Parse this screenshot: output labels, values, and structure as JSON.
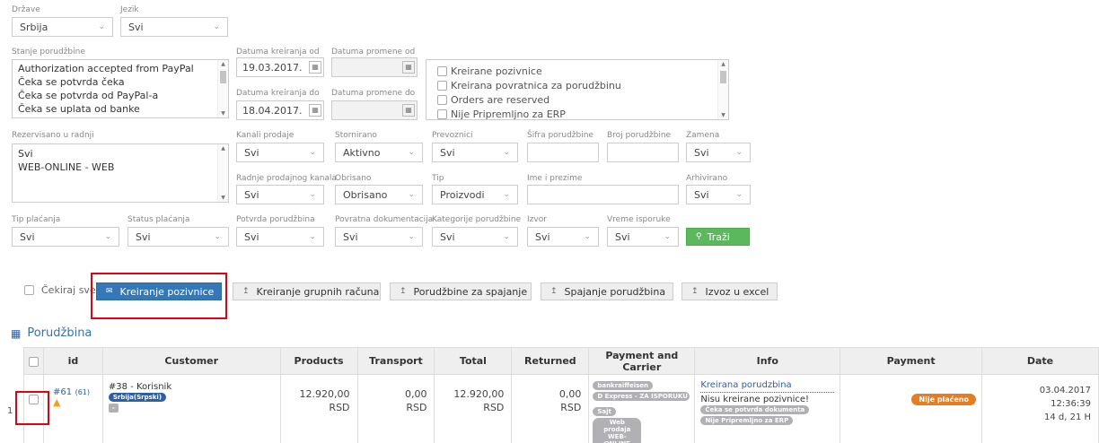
{
  "filters": {
    "drzave": {
      "label": "Države",
      "value": "Srbija"
    },
    "jezik": {
      "label": "Jezik",
      "value": "Svi"
    },
    "stanje": {
      "label": "Stanje porudžbine",
      "items": [
        "Authorization accepted from PayPal",
        "Čeka se potvrda čeka",
        "Čeka se potvrda od PayPal-a",
        "Čeka se uplata od banke"
      ]
    },
    "datum_kreiranja_od": {
      "label": "Datuma kreiranja od",
      "value": "19.03.2017."
    },
    "datum_promene_od": {
      "label": "Datuma promene od",
      "value": ""
    },
    "datum_kreiranja_do": {
      "label": "Datuma kreiranja do",
      "value": "18.04.2017."
    },
    "datum_promene_do": {
      "label": "Datuma promene do",
      "value": ""
    },
    "check_list": [
      "Kreirane pozivnice",
      "Kreirana povratnica za porudžbinu",
      "Orders are reserved",
      "Nije Pripremljno za ERP"
    ],
    "rezervisano": {
      "label": "Rezervisano u radnji",
      "items": [
        "Svi",
        "WEB-ONLINE - WEB"
      ]
    },
    "kanali": {
      "label": "Kanali prodaje",
      "value": "Svi"
    },
    "stornirano": {
      "label": "Stornirano",
      "value": "Aktivno"
    },
    "prevoznici": {
      "label": "Prevoznici",
      "value": "Svi"
    },
    "sifra": {
      "label": "Šifra porudžbine",
      "value": ""
    },
    "broj": {
      "label": "Broj porudžbine",
      "value": ""
    },
    "zamena": {
      "label": "Zamena",
      "value": "Svi"
    },
    "radnje_kanala": {
      "label": "Radnje prodajnog kanala",
      "value": "Svi"
    },
    "obrisano": {
      "label": "Obrisano",
      "value": "Obrisano"
    },
    "tip": {
      "label": "Tip",
      "value": "Proizvodi"
    },
    "ime": {
      "label": "Ime i prezime",
      "value": ""
    },
    "arhivirano": {
      "label": "Arhivirano",
      "value": "Svi"
    },
    "tip_placanja": {
      "label": "Tip plaćanja",
      "value": "Svi"
    },
    "status_placanja": {
      "label": "Status plaćanja",
      "value": "Svi"
    },
    "potvrda": {
      "label": "Potvrda porudžbina",
      "value": "Svi"
    },
    "povratna": {
      "label": "Povratna dokumentacija",
      "value": "Svi"
    },
    "kategorije": {
      "label": "Kategorije porudžbine",
      "value": "Svi"
    },
    "izvor": {
      "label": "Izvor",
      "value": "Svi"
    },
    "vreme": {
      "label": "Vreme isporuke",
      "value": "Svi"
    },
    "trazi": "Traži"
  },
  "actions": {
    "cekiraj": "Čekiraj sve",
    "kreiranje_pozivnice": "Kreiranje pozivnice",
    "grupnih": "Kreiranje grupnih računa",
    "za_spajanje": "Porudžbine za spajanje",
    "spajanje": "Spajanje porudžbina",
    "izvoz": "Izvoz u excel"
  },
  "section_title": "Porudžbina",
  "table": {
    "headers": [
      "id",
      "Customer",
      "Products",
      "Transport",
      "Total",
      "Returned",
      "Payment and Carrier",
      "Info",
      "Payment",
      "Date"
    ],
    "row": {
      "index": "1",
      "id": "#61",
      "id_sub": "(61)",
      "customer": "#38 - Korisnik",
      "customer_tag": "Srbija(Srpski)",
      "customer_extra": "-",
      "products": "12.920,00",
      "transport": "0,00",
      "total": "12.920,00",
      "returned": "0,00",
      "currency": "RSD",
      "carrier_tags": [
        "bankraiffeisen",
        "D Express - ZA ISPORUKU PO...",
        "Sajt",
        "Web prodaja WEB-ONLINE"
      ],
      "info_link": "Kreirana porudzbina",
      "info_text": "Nisu kreirane pozivnice!",
      "info_tags": [
        "Čeka se potvrda dokumenta",
        "Nije Pripremljno za ERP"
      ],
      "payment_tag": "Nije plaćeno",
      "date": "03.04.2017",
      "time": "12:36:39",
      "age": "14 d, 21 H"
    }
  }
}
